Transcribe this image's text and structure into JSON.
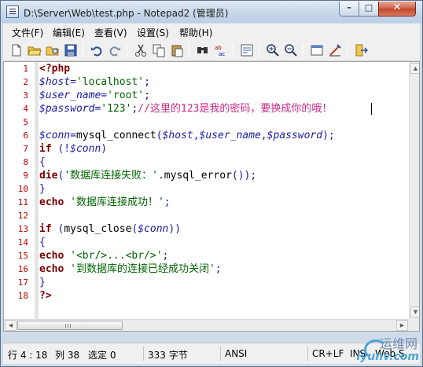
{
  "window": {
    "title": "D:\\Server\\Web\\test.php - Notepad2 (管理员)",
    "minimize_glyph": "–",
    "maximize_glyph": "□",
    "close_glyph": "✕"
  },
  "menu": {
    "file": "文件(F)",
    "edit": "编辑(E)",
    "view": "查看(V)",
    "settings": "设置(S)",
    "help": "帮助(H)"
  },
  "toolbar": {
    "icons": [
      "new-file-icon",
      "open-folder-icon",
      "browse-icon",
      "save-icon",
      "undo-icon",
      "redo-icon",
      "cut-icon",
      "copy-icon",
      "paste-icon",
      "find-icon",
      "replace-icon",
      "wrap-icon",
      "zoom-in-icon",
      "zoom-out-icon",
      "scheme-icon",
      "customize-icon",
      "exit-icon"
    ]
  },
  "editor": {
    "line_numbers": [
      "1",
      "2",
      "3",
      "4",
      "5",
      "6",
      "7",
      "8",
      "9",
      "10",
      "11",
      "12",
      "13",
      "14",
      "15",
      "16",
      "17",
      "18"
    ],
    "lines": {
      "l1": "<?php",
      "l2_var": "$host",
      "l2_op": "=",
      "l2_str": "'localhost'",
      "l2_end": ";",
      "l3_var": "$user_name",
      "l3_op": "=",
      "l3_str": "'root'",
      "l3_end": ";",
      "l4_var": "$password",
      "l4_op": "=",
      "l4_str": "'123'",
      "l4_end": ";",
      "l4_comment": "//这里的123是我的密码，要换成你的哦！",
      "l6_var": "$conn",
      "l6_op": "=",
      "l6_func": "mysql_connect",
      "l6_p1": "(",
      "l6_a1": "$host",
      "l6_c1": ",",
      "l6_a2": "$user_name",
      "l6_c2": ",",
      "l6_a3": "$password",
      "l6_p2": ");",
      "l7_kw": "if",
      "l7_p1": " (!",
      "l7_var": "$conn",
      "l7_p2": ")",
      "l8": "{",
      "l9_kw": "die",
      "l9_p1": "(",
      "l9_str": "'数据库连接失败：'",
      "l9_dot": ".",
      "l9_func": "mysql_error",
      "l9_p2": "());",
      "l10": "}",
      "l11_kw": "echo",
      "l11_str": " '数据库连接成功！'",
      "l11_end": ";",
      "l13_kw": "if",
      "l13_p1": " (",
      "l13_func": "mysql_close",
      "l13_p2": "(",
      "l13_var": "$conn",
      "l13_p3": "))",
      "l14": "{",
      "l15_kw": "echo",
      "l15_str": " '<br/>...<br/>'",
      "l15_end": ";",
      "l16_kw": "echo",
      "l16_str": " '到数据库的连接已经成功关闭'",
      "l16_end": ";",
      "l17": "}",
      "l18": "?>"
    },
    "hscroll_thumb_grip": "|||"
  },
  "status": {
    "position": "行 4 : 18",
    "column": "列 38",
    "selection": "选定 0",
    "size": "333 字节",
    "encoding": "ANSI",
    "line_ending": "CR+LF",
    "insert_mode": "INS",
    "scheme": "Web S"
  },
  "watermark": {
    "top": "运维网",
    "bottom": "iyunv.com"
  },
  "colors": {
    "keyword": "#7a0000",
    "variable": "#1a1aa0",
    "string": "#006400",
    "comment": "#cc2a88",
    "line_number": "#c00000"
  }
}
